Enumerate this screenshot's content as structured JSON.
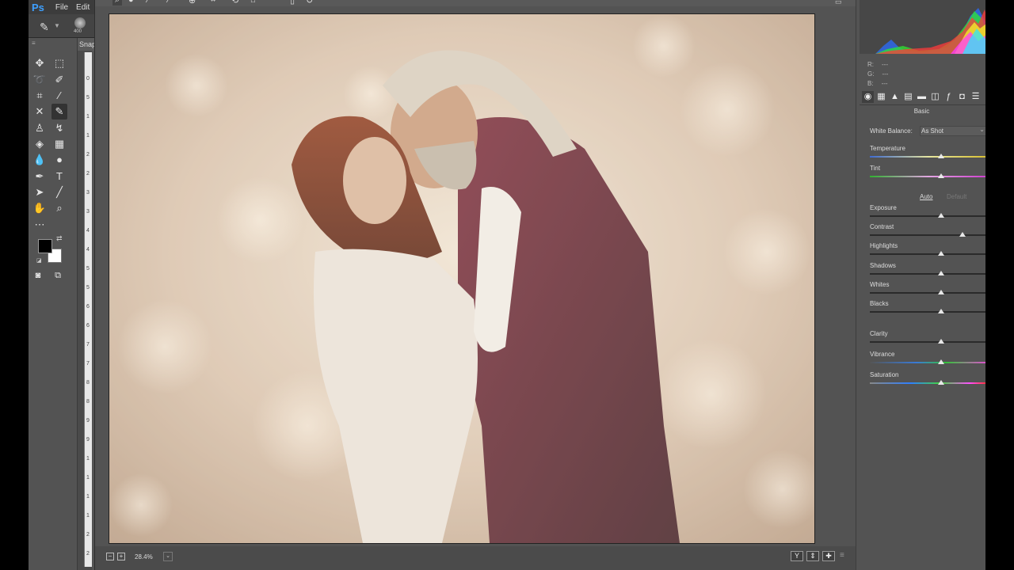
{
  "menubar": {
    "app_logo": "Ps",
    "menu_file": "File",
    "menu_edit": "Edit"
  },
  "options": {
    "brush_size": "400"
  },
  "document": {
    "tab_label": "Snap"
  },
  "ruler": {
    "ticks": [
      "0",
      "5",
      "1",
      "1",
      "2",
      "2",
      "3",
      "3",
      "4",
      "4",
      "5",
      "5",
      "6",
      "6",
      "7",
      "7",
      "8",
      "8",
      "9",
      "9",
      "1",
      "1",
      "1",
      "1",
      "2",
      "2"
    ]
  },
  "bottombar": {
    "zoom_out": "−",
    "zoom_in": "+",
    "zoom_level": "28.4%",
    "zoom_dropdown": "⌄",
    "btn_y": "Y",
    "btn_compare": "⇕",
    "btn_cycle": "✚"
  },
  "histogram": {
    "colors": {
      "red": "#ff3a3a",
      "green": "#2ee82e",
      "blue": "#2a6cff",
      "yellow": "#f5f52a",
      "magenta": "#ff3cff",
      "cyan": "#2ee6ff"
    }
  },
  "readout": {
    "r_label": "R:",
    "g_label": "G:",
    "b_label": "B:",
    "r_value": "---",
    "g_value": "---",
    "b_value": "---"
  },
  "panel": {
    "title": "Basic",
    "white_balance_label": "White Balance:",
    "white_balance_value": "As Shot",
    "auto_label": "Auto",
    "default_label": "Default",
    "sliders": [
      {
        "label": "Temperature",
        "value": "0"
      },
      {
        "label": "Tint",
        "value": "0"
      },
      {
        "label": "Exposure",
        "value": "0.00"
      },
      {
        "label": "Contrast",
        "value": "+28"
      },
      {
        "label": "Highlights",
        "value": "0"
      },
      {
        "label": "Shadows",
        "value": "0"
      },
      {
        "label": "Whites",
        "value": "0"
      },
      {
        "label": "Blacks",
        "value": "0"
      },
      {
        "label": "Clarity",
        "value": "0"
      },
      {
        "label": "Vibrance",
        "value": "0"
      },
      {
        "label": "Saturation",
        "value": "0"
      }
    ]
  }
}
